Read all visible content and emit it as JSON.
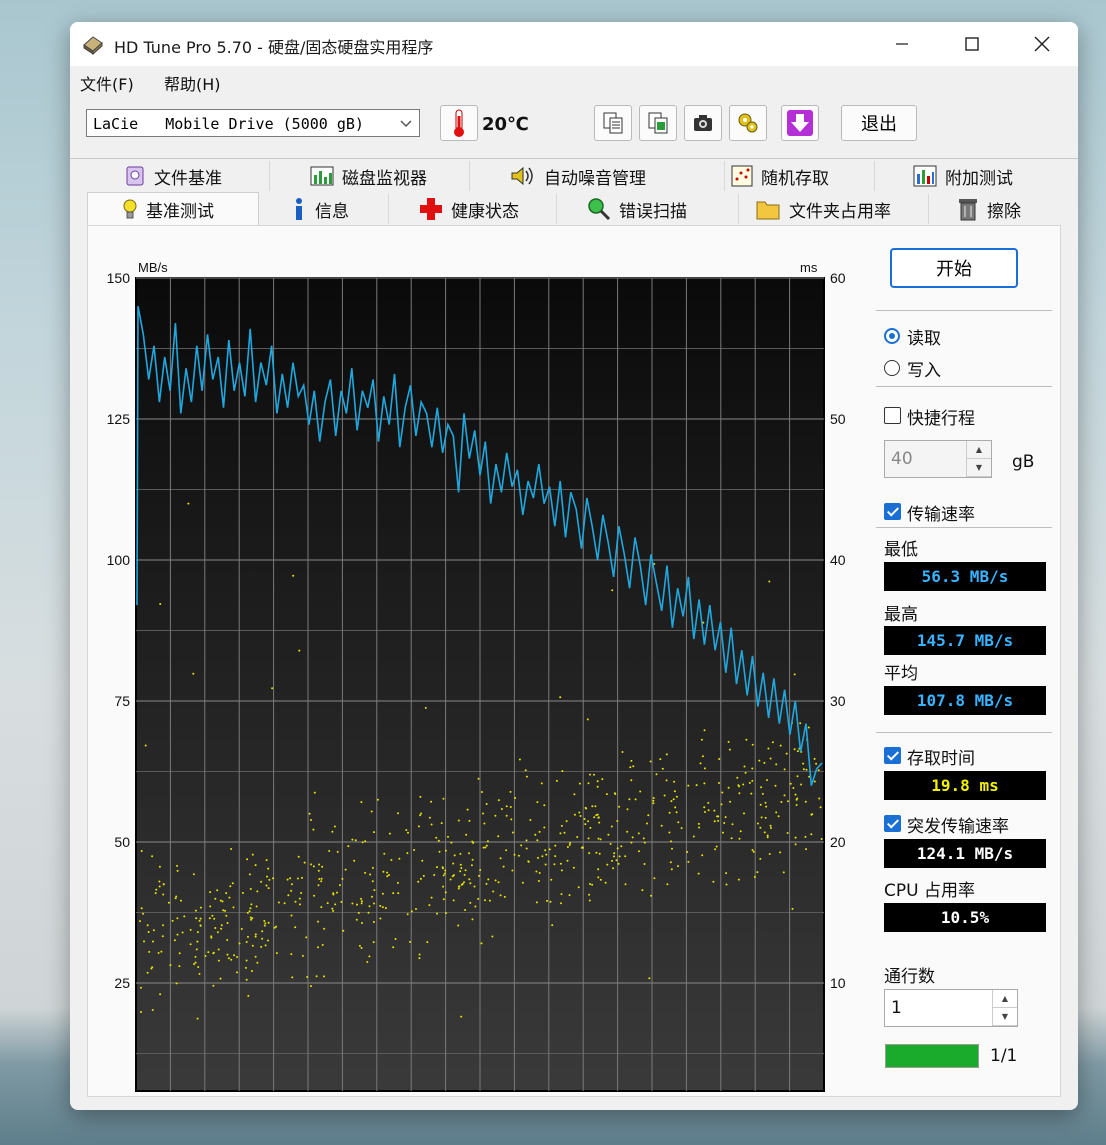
{
  "window": {
    "title": "HD Tune Pro 5.70 - 硬盘/固态硬盘实用程序"
  },
  "menu": [
    "文件(F)",
    "帮助(H)"
  ],
  "toolbar": {
    "drive": "LaCie   Mobile Drive (5000 gB)",
    "temperature": "20℃",
    "exit_label": "退出"
  },
  "tabs_row1": [
    "文件基准",
    "磁盘监视器",
    "自动噪音管理",
    "随机存取",
    "附加测试"
  ],
  "tabs_row2": [
    "基准测试",
    "信息",
    "健康状态",
    "错误扫描",
    "文件夹占用率",
    "擦除"
  ],
  "active_tab": "基准测试",
  "side": {
    "start_label": "开始",
    "read_label": "读取",
    "write_label": "写入",
    "mode_selected": "读取",
    "short_stroke_label": "快捷行程",
    "short_stroke_checked": false,
    "short_stroke_value": "40",
    "short_stroke_unit": "gB",
    "transfer_rate_label": "传输速率",
    "transfer_rate_checked": true,
    "min_label": "最低",
    "min_value": "56.3 MB/s",
    "max_label": "最高",
    "max_value": "145.7 MB/s",
    "avg_label": "平均",
    "avg_value": "107.8 MB/s",
    "access_time_label": "存取时间",
    "access_time_checked": true,
    "access_time_value": "19.8 ms",
    "burst_label": "突发传输速率",
    "burst_checked": true,
    "burst_value": "124.1 MB/s",
    "cpu_label": "CPU 占用率",
    "cpu_value": "10.5%",
    "passes_label": "通行数",
    "passes_value": "1",
    "progress_text": "1/1",
    "progress_fraction": 1.0
  },
  "chart_data": {
    "type": "line",
    "y_left_label": "MB/s",
    "y_right_label": "ms",
    "y_left_ticks": [
      "150",
      "125",
      "100",
      "75",
      "50",
      "25"
    ],
    "y_right_ticks": [
      "60",
      "50",
      "40",
      "30",
      "20",
      "10"
    ],
    "ylim_left": [
      0,
      150
    ],
    "ylim_right": [
      0,
      60
    ],
    "grid": true,
    "series": [
      {
        "name": "",
        "kind": "line",
        "color": "#1fa8e0",
        "values": [
          145,
          140,
          132,
          138,
          128,
          136,
          130,
          142,
          126,
          134,
          128,
          138,
          130,
          140,
          132,
          136,
          127,
          139,
          130,
          135,
          129,
          141,
          128,
          135,
          131,
          138,
          126,
          133,
          127,
          135,
          129,
          131,
          124,
          130,
          121,
          128,
          132,
          122,
          130,
          126,
          134,
          123,
          130,
          127,
          132,
          121,
          129,
          124,
          133,
          120,
          127,
          131,
          122,
          128,
          126,
          120,
          127,
          119,
          124,
          122,
          112,
          126,
          118,
          123,
          115,
          121,
          110,
          117,
          112,
          119,
          113,
          116,
          108,
          114,
          111,
          117,
          110,
          113,
          106,
          114,
          104,
          112,
          109,
          102,
          111,
          106,
          100,
          108,
          103,
          97,
          106,
          101,
          95,
          104,
          99,
          92,
          101,
          96,
          91,
          99,
          88,
          95,
          90,
          97,
          86,
          93,
          85,
          92,
          84,
          89,
          80,
          88,
          78,
          84,
          76,
          83,
          74,
          80,
          72,
          79,
          71,
          77,
          69,
          75,
          66,
          71,
          60,
          63,
          64
        ]
      },
      {
        "name": "",
        "kind": "scatter",
        "color": "#e6e600",
        "axis": "right",
        "description_values_note": ""
      }
    ]
  },
  "colors": {
    "line": "#1fa8e0",
    "dots": "#e6e600",
    "graph_bg": "#141414",
    "accent": "#1a6fd4",
    "progress": "#1aab2d"
  }
}
